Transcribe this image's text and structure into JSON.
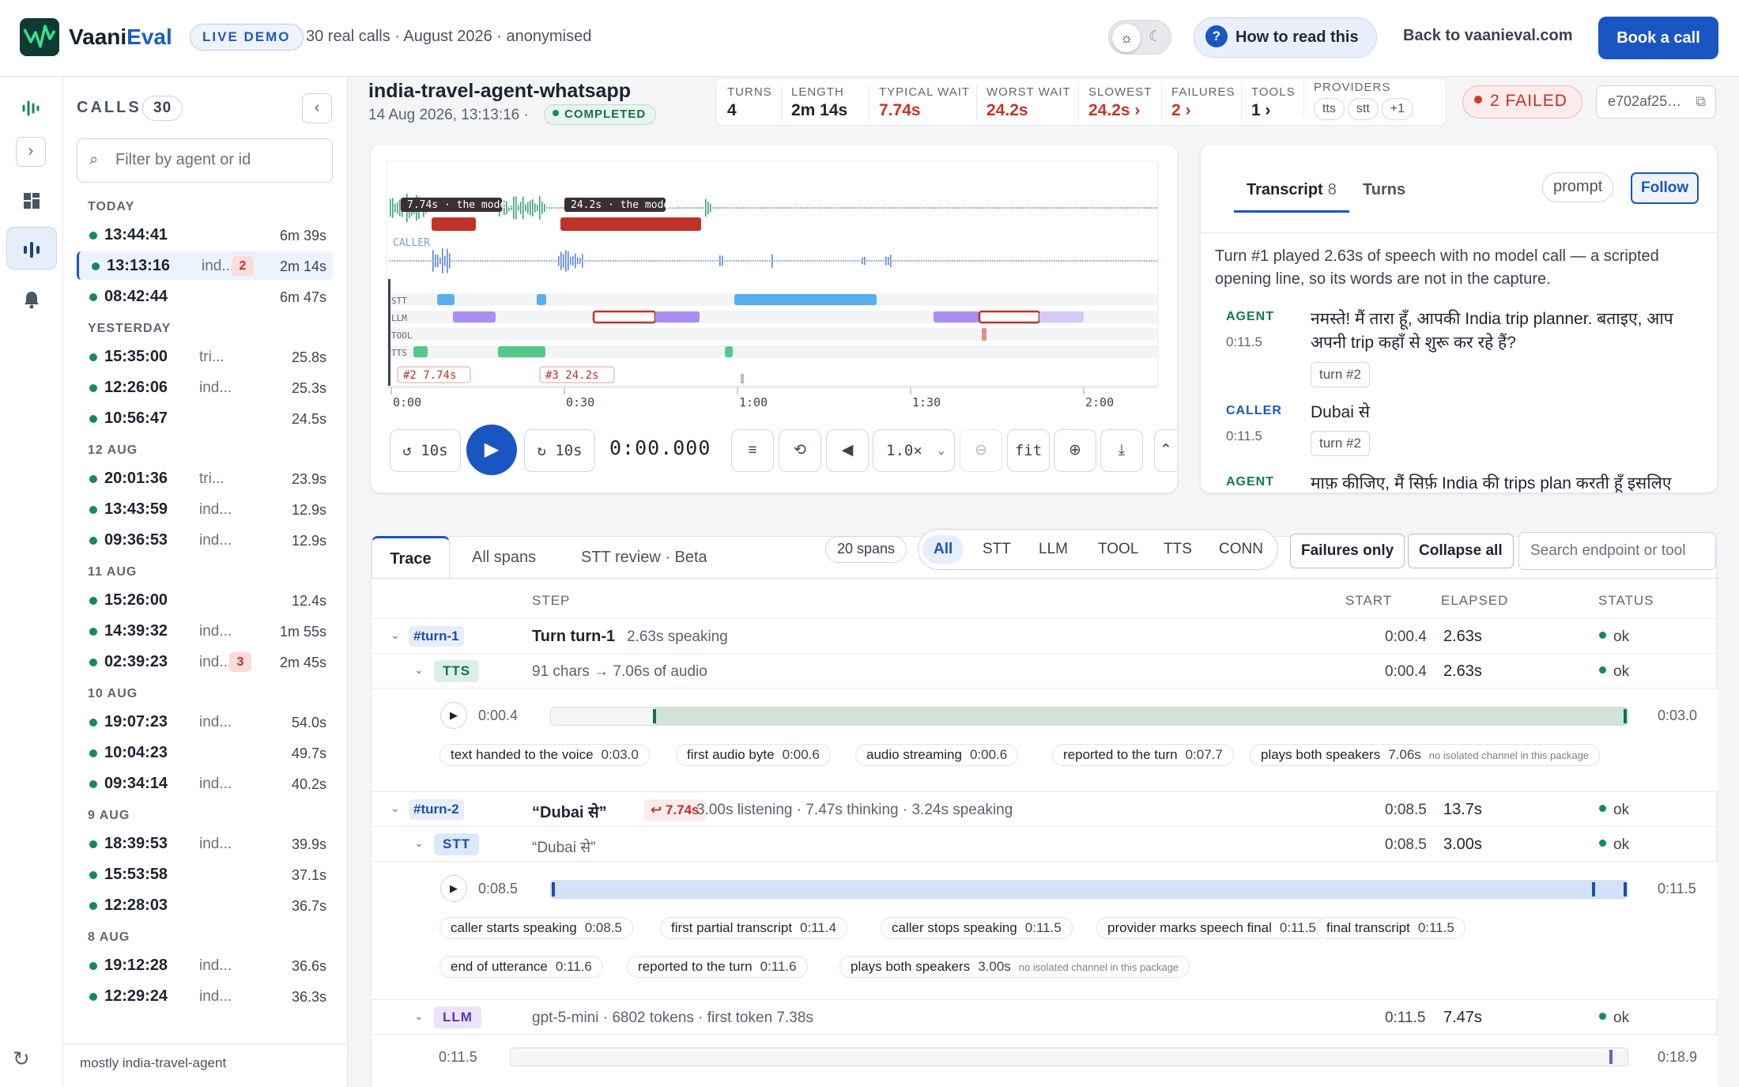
{
  "app": {
    "brand_a": "Vaani",
    "brand_b": "Eval",
    "live_badge": "LIVE DEMO",
    "subtitle": "30 real calls · August 2026 · anonymised"
  },
  "header": {
    "how_to": "How to read this",
    "back": "Back to vaanieval.com",
    "book": "Book a call",
    "theme_light_icon": "sun-icon",
    "theme_dark_icon": "moon-icon"
  },
  "calls": {
    "heading": "CALLS",
    "count": "30",
    "filter_placeholder": "Filter by agent or id",
    "footer": "mostly india-travel-agent",
    "groups": [
      {
        "label": "TODAY",
        "items": [
          {
            "time": "13:44:41",
            "agent": "",
            "badge": "",
            "dur": "6m 39s"
          },
          {
            "time": "13:13:16",
            "agent": "ind...",
            "badge": "2",
            "dur": "2m 14s"
          },
          {
            "time": "08:42:44",
            "agent": "",
            "badge": "",
            "dur": "6m 47s"
          }
        ]
      },
      {
        "label": "YESTERDAY",
        "items": [
          {
            "time": "15:35:00",
            "agent": "tri...",
            "badge": "",
            "dur": "25.8s"
          },
          {
            "time": "12:26:06",
            "agent": "ind...",
            "badge": "",
            "dur": "25.3s"
          },
          {
            "time": "10:56:47",
            "agent": "",
            "badge": "",
            "dur": "24.5s"
          }
        ]
      },
      {
        "label": "12 AUG",
        "items": [
          {
            "time": "20:01:36",
            "agent": "tri...",
            "badge": "",
            "dur": "23.9s"
          },
          {
            "time": "13:43:59",
            "agent": "ind...",
            "badge": "",
            "dur": "12.9s"
          },
          {
            "time": "09:36:53",
            "agent": "ind...",
            "badge": "",
            "dur": "12.9s"
          }
        ]
      },
      {
        "label": "11 AUG",
        "items": [
          {
            "time": "15:26:00",
            "agent": "",
            "badge": "",
            "dur": "12.4s"
          },
          {
            "time": "14:39:32",
            "agent": "ind...",
            "badge": "",
            "dur": "1m 55s"
          },
          {
            "time": "02:39:23",
            "agent": "ind...",
            "badge": "3",
            "dur": "2m 45s"
          }
        ]
      },
      {
        "label": "10 AUG",
        "items": [
          {
            "time": "19:07:23",
            "agent": "ind...",
            "badge": "",
            "dur": "54.0s"
          },
          {
            "time": "10:04:23",
            "agent": "",
            "badge": "",
            "dur": "49.7s"
          },
          {
            "time": "09:34:14",
            "agent": "ind...",
            "badge": "",
            "dur": "40.2s"
          }
        ]
      },
      {
        "label": "9 AUG",
        "items": [
          {
            "time": "18:39:53",
            "agent": "ind...",
            "badge": "",
            "dur": "39.9s"
          },
          {
            "time": "15:53:58",
            "agent": "",
            "badge": "",
            "dur": "37.1s"
          },
          {
            "time": "12:28:03",
            "agent": "",
            "badge": "",
            "dur": "36.7s"
          }
        ]
      },
      {
        "label": "8 AUG",
        "items": [
          {
            "time": "19:12:28",
            "agent": "ind...",
            "badge": "",
            "dur": "36.6s"
          },
          {
            "time": "12:29:24",
            "agent": "ind...",
            "badge": "",
            "dur": "36.3s"
          }
        ]
      }
    ]
  },
  "call": {
    "title": "india-travel-agent-whatsapp",
    "date": "14 Aug 2026, 13:13:16",
    "status": "COMPLETED",
    "stats": {
      "turns_l": "TURNS",
      "turns": "4",
      "length_l": "LENGTH",
      "length": "2m 14s",
      "wait_l": "TYPICAL WAIT",
      "wait": "7.74s",
      "worst_l": "WORST WAIT",
      "worst": "24.2s",
      "slowest_l": "SLOWEST",
      "slowest": "24.2s ›",
      "failures_l": "FAILURES",
      "failures": "2 ›",
      "tools_l": "TOOLS",
      "tools": "1 ›",
      "providers_l": "PROVIDERS",
      "providers": [
        "tts",
        "stt",
        "+1"
      ]
    },
    "failed": "2 FAILED",
    "hash": "e702af25…"
  },
  "player": {
    "wait_labels": [
      "7.74s · the model",
      "24.2s · the model"
    ],
    "caller_label": "CALLER",
    "lanes": [
      "STT",
      "LLM",
      "TOOL",
      "TTS"
    ],
    "turn_markers": [
      "#2 7.74s",
      "#3 24.2s"
    ],
    "ticks": [
      "0:00",
      "0:30",
      "1:00",
      "1:30",
      "2:00"
    ],
    "back10": "10s",
    "fwd10": "10s",
    "clock": "0:00.000",
    "speed": "1.0×",
    "fit": "fit"
  },
  "transcript": {
    "tab1": "Transcript",
    "tab1_count": "8",
    "tab2": "Turns",
    "prompt": "prompt",
    "follow": "Follow",
    "note": "Turn #1 played 2.63s of speech with no model call — a scripted opening line, so its words are not in the capture.",
    "entries": [
      {
        "who": "AGENT",
        "ts": "0:11.5",
        "text": "नमस्ते! मैं तारा हूँ, आपकी India trip planner. बताइए, आप अपनी trip कहाँ से शुरू कर रहे हैं?",
        "chip": "turn #2"
      },
      {
        "who": "CALLER",
        "ts": "0:11.5",
        "text": "Dubai से",
        "chip": "turn #2"
      },
      {
        "who": "AGENT",
        "ts": "",
        "text": "माफ़ कीजिए, मैं सिर्फ़ India की trips plan करती हूँ इसलिए",
        "chip": ""
      }
    ]
  },
  "trace": {
    "tabs": [
      "Trace",
      "All spans",
      "STT review · Beta"
    ],
    "spans": "20 spans",
    "filters": [
      "All",
      "STT",
      "LLM",
      "TOOL",
      "TTS",
      "CONN"
    ],
    "failures_only": "Failures only",
    "collapse_all": "Collapse all",
    "search_placeholder": "Search endpoint or tool",
    "cols": {
      "step": "STEP",
      "start": "START",
      "elapsed": "ELAPSED",
      "status": "STATUS"
    },
    "turn1": {
      "id": "#turn-1",
      "title": "Turn turn-1",
      "sub": "2.63s speaking",
      "start": "0:00.4",
      "elapsed": "2.63s",
      "status": "ok"
    },
    "tts": {
      "kind": "TTS",
      "sub": "91 chars → 7.06s of audio",
      "start": "0:00.4",
      "elapsed": "2.63s",
      "status": "ok",
      "t0": "0:00.4",
      "t1": "0:03.0",
      "level_start_pct": 9.6,
      "level_end_pct": 100,
      "marks": [
        {
          "k": "text handed to the voice",
          "v": "0:03.0"
        },
        {
          "k": "first audio byte",
          "v": "0:00.6"
        },
        {
          "k": "audio streaming",
          "v": "0:00.6"
        },
        {
          "k": "reported to the turn",
          "v": "0:07.7"
        },
        {
          "k": "plays both speakers",
          "v": "7.06s",
          "note": "no isolated channel in this package"
        }
      ]
    },
    "turn2": {
      "id": "#turn-2",
      "title": "“Dubai से”",
      "wait": "↩ 7.74s",
      "sub": "3.00s listening · 7.47s thinking · 3.24s speaking",
      "start": "0:08.5",
      "elapsed": "13.7s",
      "status": "ok"
    },
    "stt": {
      "kind": "STT",
      "sub": "“Dubai से”",
      "start": "0:08.5",
      "elapsed": "3.00s",
      "status": "ok",
      "t0": "0:08.5",
      "t1": "0:11.5",
      "marks": [
        {
          "k": "caller starts speaking",
          "v": "0:08.5"
        },
        {
          "k": "first partial transcript",
          "v": "0:11.4"
        },
        {
          "k": "caller stops speaking",
          "v": "0:11.5"
        },
        {
          "k": "provider marks speech final",
          "v": "0:11.5"
        },
        {
          "k": "final transcript",
          "v": "0:11.5"
        }
      ],
      "marks2": [
        {
          "k": "end of utterance",
          "v": "0:11.6"
        },
        {
          "k": "reported to the turn",
          "v": "0:11.6"
        },
        {
          "k": "plays both speakers",
          "v": "3.00s",
          "note": "no isolated channel in this package"
        }
      ]
    },
    "llm": {
      "kind": "LLM",
      "sub": "gpt-5-mini · 6802 tokens · first token 7.38s",
      "start": "0:11.5",
      "elapsed": "7.47s",
      "status": "ok",
      "t0": "0:11.5",
      "t1": "0:18.9"
    }
  },
  "colors": {
    "accent": "#1a56c2",
    "ok": "#17885a",
    "fail": "#c7342b",
    "agent_wave": "#3fa274",
    "caller_wave": "#5b86d6",
    "stt": "#5aaef0",
    "llm": "#a98df0",
    "tts": "#54c98a"
  }
}
